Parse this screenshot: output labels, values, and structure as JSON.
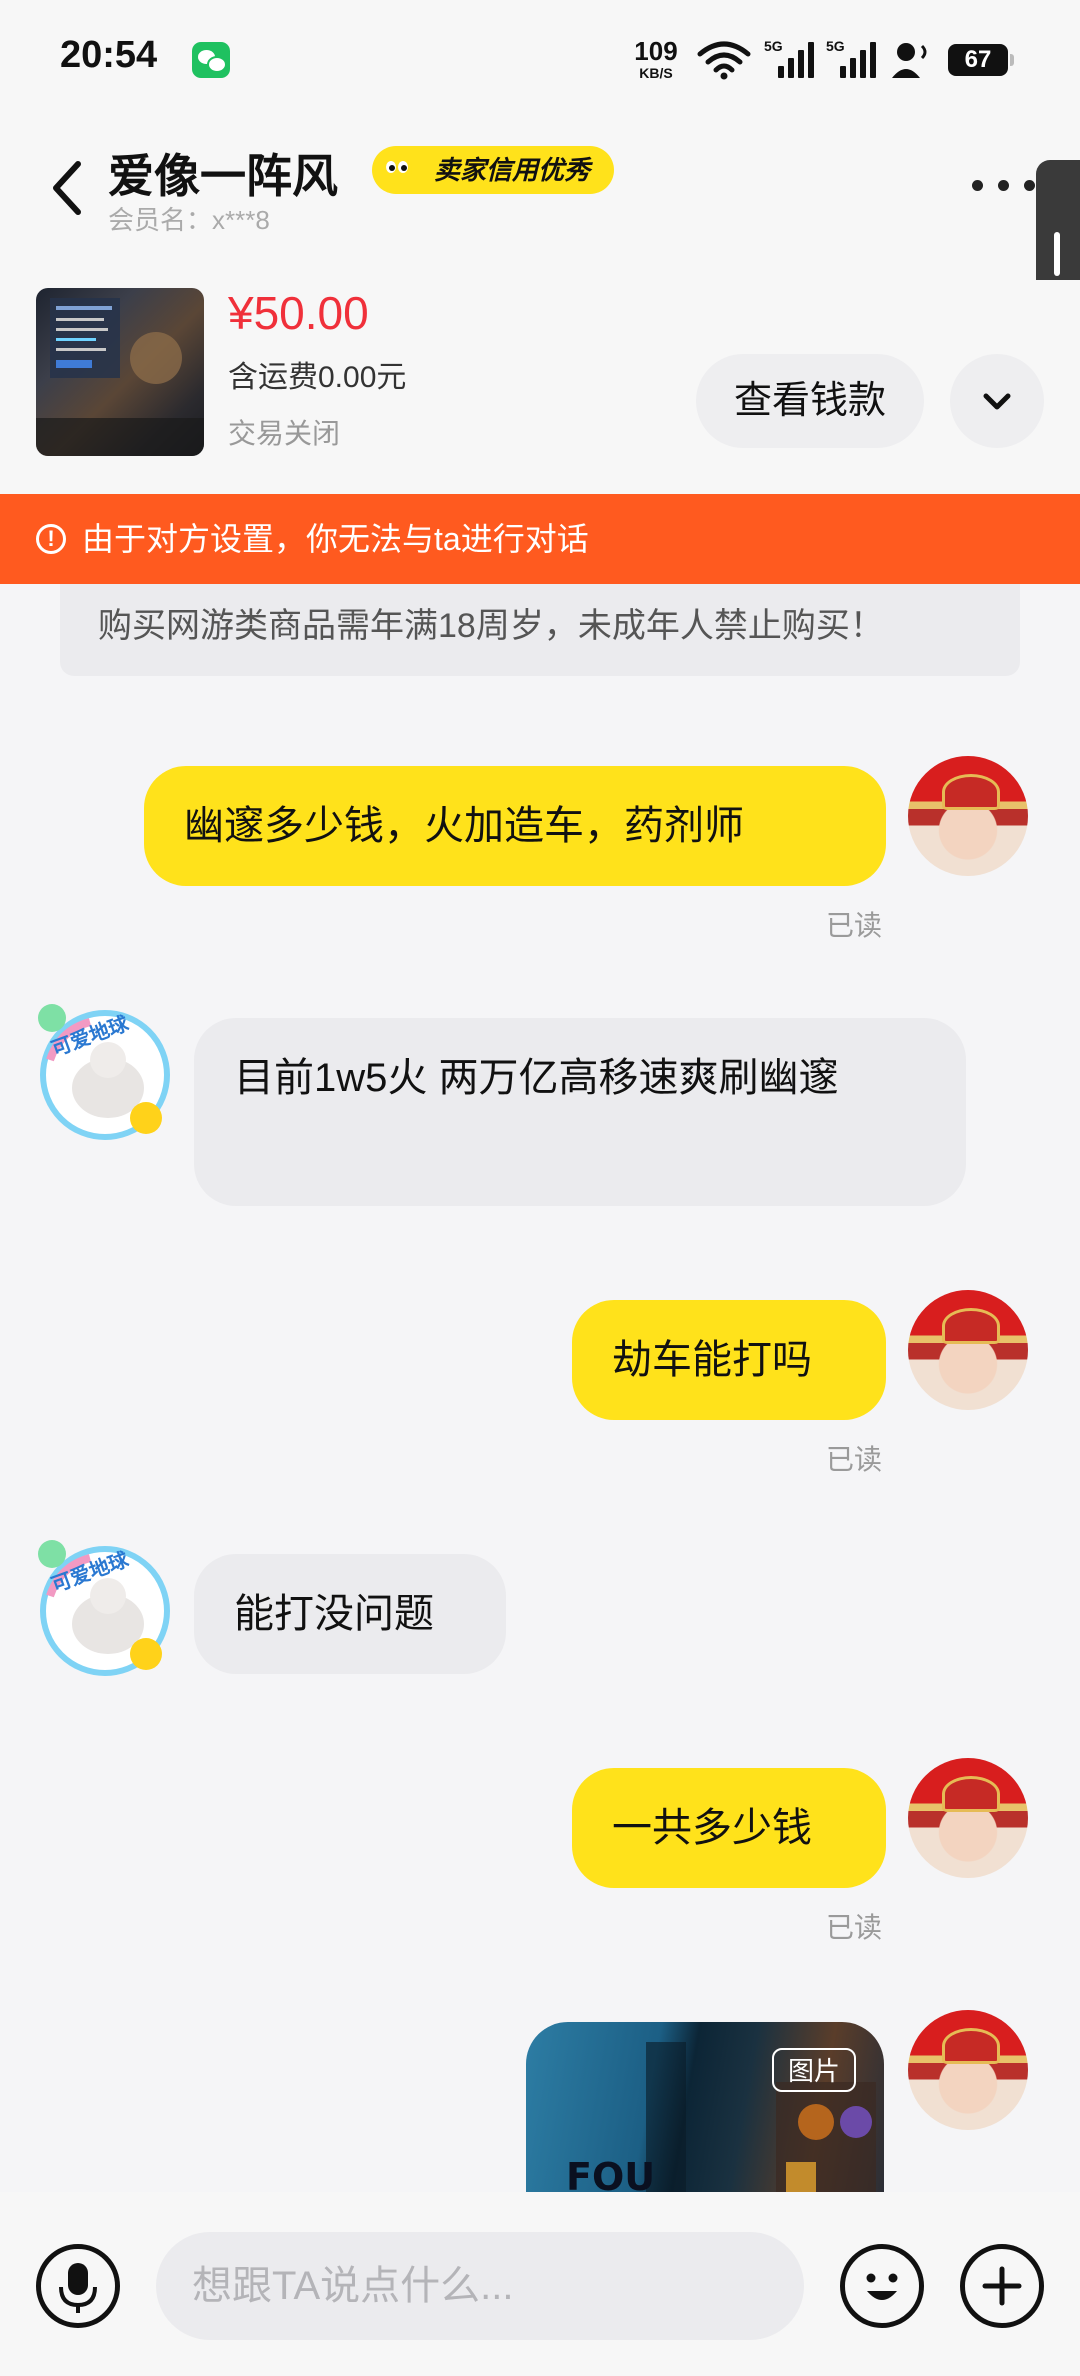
{
  "status_bar": {
    "time": "20:54",
    "net_speed": "109",
    "net_unit": "KB/S",
    "sim1": "5G",
    "sim2": "5G",
    "battery": "67"
  },
  "header": {
    "title": "爱像一阵风",
    "badge": "卖家信用优秀",
    "member_label": "会员名：x***8"
  },
  "product": {
    "price": "¥50.00",
    "shipping": "含运费0.00元",
    "status": "交易关闭",
    "view_button": "查看钱款"
  },
  "warning": {
    "text": "由于对方设置，你无法与ta进行对话"
  },
  "notice": {
    "text": "购买网游类商品需年满18周岁，未成年人禁止购买！"
  },
  "messages": [
    {
      "from": "me",
      "text": "幽邃多少钱，火加造车，药剂师",
      "status": "已读"
    },
    {
      "from": "them",
      "text": "目前1w5火 两万亿高移速爽刷幽邃"
    },
    {
      "from": "me",
      "text": "劫车能打吗",
      "status": "已读"
    },
    {
      "from": "them",
      "text": "能打没问题"
    },
    {
      "from": "me",
      "text": "一共多少钱",
      "status": "已读"
    },
    {
      "from": "me",
      "type": "image",
      "tag": "图片"
    }
  ],
  "peer_avatar_text": "可爱地球",
  "input": {
    "placeholder": "想跟TA说点什么..."
  },
  "colors": {
    "accent_yellow": "#ffe21b",
    "price_red": "#f0303a",
    "warning_orange": "#ff5a1f"
  },
  "icons": [
    "back-arrow-icon",
    "more-icon",
    "chevron-down-icon",
    "warning-icon",
    "microphone-icon",
    "emoji-icon",
    "plus-icon",
    "wechat-icon",
    "wifi-icon",
    "signal-icon",
    "battery-icon"
  ]
}
